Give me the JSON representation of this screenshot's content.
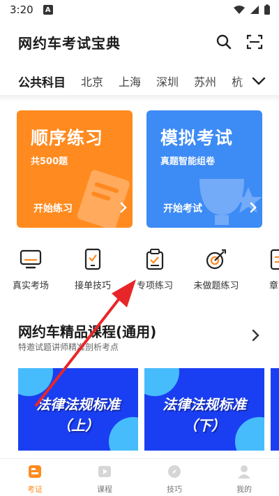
{
  "status_bar": {
    "time": "3:20",
    "badge": "A"
  },
  "header": {
    "title": "网约车考试宝典",
    "search_icon": "search-icon",
    "scan_icon": "scan-icon"
  },
  "tabs": [
    {
      "label": "公共科目",
      "active": true
    },
    {
      "label": "北京",
      "active": false
    },
    {
      "label": "上海",
      "active": false
    },
    {
      "label": "深圳",
      "active": false
    },
    {
      "label": "苏州",
      "active": false
    },
    {
      "label": "杭",
      "active": false
    }
  ],
  "cards": {
    "order": {
      "title": "顺序练习",
      "subtitle": "共500题",
      "action": "开始练习",
      "color": "#ff8a1f"
    },
    "mock": {
      "title": "模拟考试",
      "subtitle": "真题智能组卷",
      "action": "开始考试",
      "color": "#3d8bf5"
    }
  },
  "quick_actions": [
    {
      "label": "真实考场",
      "icon": "monitor-icon"
    },
    {
      "label": "接单技巧",
      "icon": "phone-icon"
    },
    {
      "label": "专项练习",
      "icon": "clipboard-icon"
    },
    {
      "label": "未做题练习",
      "icon": "target-icon"
    },
    {
      "label": "章节",
      "icon": "book-icon"
    }
  ],
  "courses": {
    "title": "网约车精品课程(通用)",
    "subtitle": "特邀试题讲师精准剖析考点",
    "items": [
      {
        "title": "法律法规标准",
        "part": "（上）"
      },
      {
        "title": "法律法规标准",
        "part": "（下）"
      }
    ]
  },
  "bottom_nav": [
    {
      "label": "考证",
      "icon": "exam-icon",
      "active": true
    },
    {
      "label": "课程",
      "icon": "play-icon",
      "active": false
    },
    {
      "label": "技巧",
      "icon": "compass-icon",
      "active": false
    },
    {
      "label": "我的",
      "icon": "profile-icon",
      "active": false
    }
  ],
  "colors": {
    "accent": "#ff8a1f",
    "blue": "#3d8bf5",
    "annotation": "#e8262a"
  }
}
